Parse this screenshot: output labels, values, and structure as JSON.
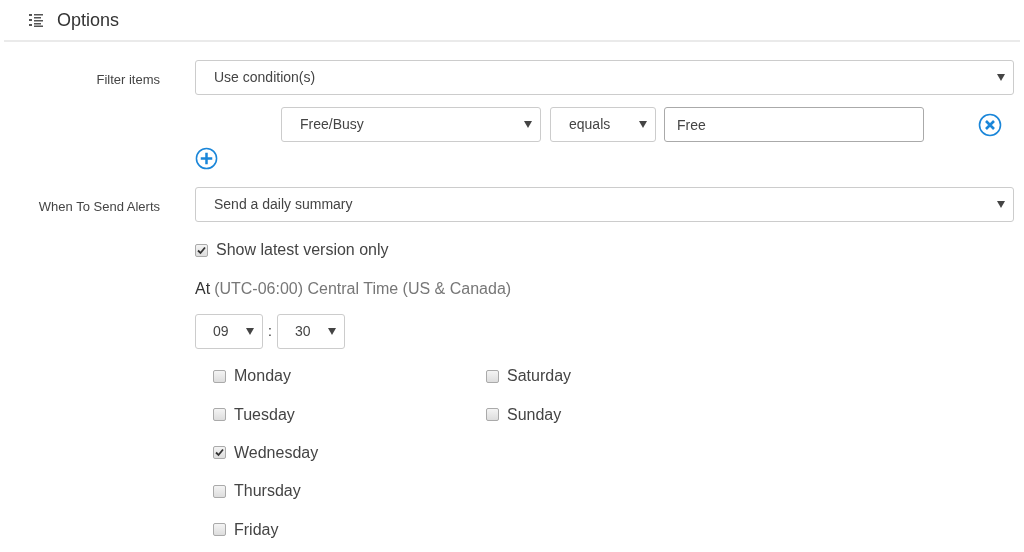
{
  "header": {
    "title": "Options"
  },
  "filter": {
    "label": "Filter items",
    "value": "Use condition(s)",
    "conditions": [
      {
        "field": "Free/Busy",
        "operator": "equals",
        "value": "Free"
      }
    ]
  },
  "alerts": {
    "label": "When To Send Alerts",
    "value": "Send a daily summary",
    "latest_only": {
      "label": "Show latest version only",
      "checked": true
    },
    "at_label": "At",
    "timezone": "(UTC-06:00) Central Time (US & Canada)",
    "hour": "09",
    "separator": ":",
    "minute": "30",
    "days": [
      {
        "label": "Monday",
        "checked": false
      },
      {
        "label": "Tuesday",
        "checked": false
      },
      {
        "label": "Wednesday",
        "checked": true
      },
      {
        "label": "Thursday",
        "checked": false
      },
      {
        "label": "Friday",
        "checked": false
      },
      {
        "label": "Saturday",
        "checked": false
      },
      {
        "label": "Sunday",
        "checked": false
      }
    ]
  }
}
